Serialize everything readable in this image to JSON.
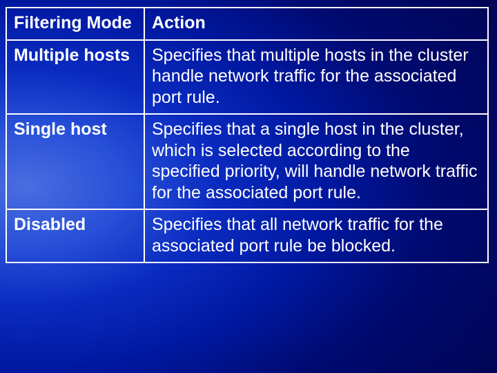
{
  "table": {
    "headers": {
      "mode": "Filtering Mode",
      "action": "Action"
    },
    "rows": [
      {
        "mode": "Multiple hosts",
        "action": "Specifies that multiple hosts in the cluster handle network traffic for the associated port rule."
      },
      {
        "mode": "Single host",
        "action": "Specifies that a single host in the cluster, which is selected according to the specified priority, will handle network traffic for the associated port rule."
      },
      {
        "mode": "Disabled",
        "action": "Specifies that all network traffic for the associated port rule be blocked."
      }
    ]
  }
}
